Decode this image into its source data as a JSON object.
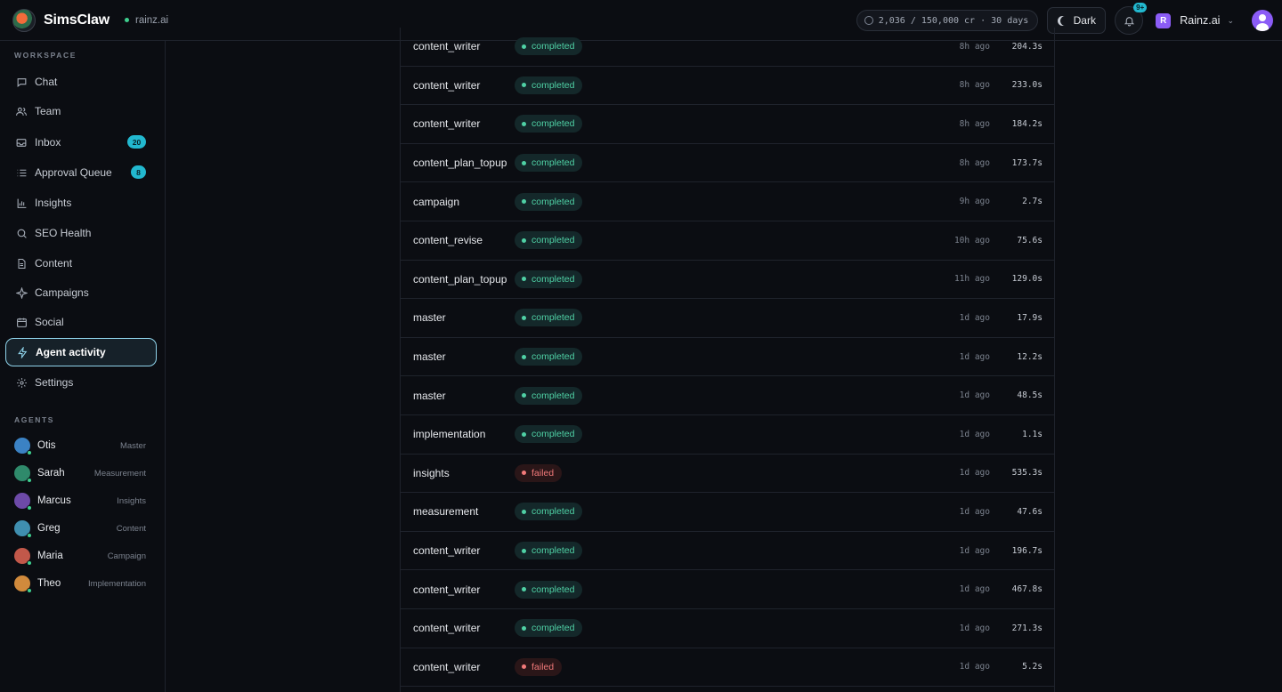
{
  "header": {
    "brand": "SimsClaw",
    "workspace": "rainz.ai",
    "credits": "2,036 / 150,000 cr · 30 days",
    "theme_label": "Dark",
    "notifications_badge": "9+",
    "org_initial": "R",
    "org_name": "Rainz.ai"
  },
  "sidebar": {
    "workspace_title": "WORKSPACE",
    "items": [
      {
        "label": "Chat",
        "icon": "chat-icon"
      },
      {
        "label": "Team",
        "icon": "team-icon"
      },
      {
        "label": "Inbox",
        "icon": "inbox-icon",
        "badge": "20"
      },
      {
        "label": "Approval Queue",
        "icon": "list-icon",
        "badge": "8"
      },
      {
        "label": "Insights",
        "icon": "bar-chart-icon"
      },
      {
        "label": "SEO Health",
        "icon": "search-icon"
      },
      {
        "label": "Content",
        "icon": "document-icon"
      },
      {
        "label": "Campaigns",
        "icon": "sparkle-icon"
      },
      {
        "label": "Social",
        "icon": "calendar-icon"
      },
      {
        "label": "Agent activity",
        "icon": "lightning-icon",
        "active": true
      },
      {
        "label": "Settings",
        "icon": "gear-icon"
      }
    ],
    "agents_title": "AGENTS",
    "agents": [
      {
        "name": "Otis",
        "role": "Master",
        "color": "#3b82c4"
      },
      {
        "name": "Sarah",
        "role": "Measurement",
        "color": "#2f8a6b"
      },
      {
        "name": "Marcus",
        "role": "Insights",
        "color": "#6d4aa8"
      },
      {
        "name": "Greg",
        "role": "Content",
        "color": "#3f8fb0"
      },
      {
        "name": "Maria",
        "role": "Campaign",
        "color": "#c2584a"
      },
      {
        "name": "Theo",
        "role": "Implementation",
        "color": "#d08a3c"
      }
    ]
  },
  "activity": [
    {
      "name": "content_writer",
      "status": "completed",
      "ago": "8h ago",
      "duration": "204.3s"
    },
    {
      "name": "content_writer",
      "status": "completed",
      "ago": "8h ago",
      "duration": "233.0s"
    },
    {
      "name": "content_writer",
      "status": "completed",
      "ago": "8h ago",
      "duration": "184.2s"
    },
    {
      "name": "content_plan_topup",
      "status": "completed",
      "ago": "8h ago",
      "duration": "173.7s"
    },
    {
      "name": "campaign",
      "status": "completed",
      "ago": "9h ago",
      "duration": "2.7s"
    },
    {
      "name": "content_revise",
      "status": "completed",
      "ago": "10h ago",
      "duration": "75.6s"
    },
    {
      "name": "content_plan_topup",
      "status": "completed",
      "ago": "11h ago",
      "duration": "129.0s"
    },
    {
      "name": "master",
      "status": "completed",
      "ago": "1d ago",
      "duration": "17.9s"
    },
    {
      "name": "master",
      "status": "completed",
      "ago": "1d ago",
      "duration": "12.2s"
    },
    {
      "name": "master",
      "status": "completed",
      "ago": "1d ago",
      "duration": "48.5s"
    },
    {
      "name": "implementation",
      "status": "completed",
      "ago": "1d ago",
      "duration": "1.1s"
    },
    {
      "name": "insights",
      "status": "failed",
      "ago": "1d ago",
      "duration": "535.3s"
    },
    {
      "name": "measurement",
      "status": "completed",
      "ago": "1d ago",
      "duration": "47.6s"
    },
    {
      "name": "content_writer",
      "status": "completed",
      "ago": "1d ago",
      "duration": "196.7s"
    },
    {
      "name": "content_writer",
      "status": "completed",
      "ago": "1d ago",
      "duration": "467.8s"
    },
    {
      "name": "content_writer",
      "status": "completed",
      "ago": "1d ago",
      "duration": "271.3s"
    },
    {
      "name": "content_writer",
      "status": "failed",
      "ago": "1d ago",
      "duration": "5.2s"
    }
  ]
}
